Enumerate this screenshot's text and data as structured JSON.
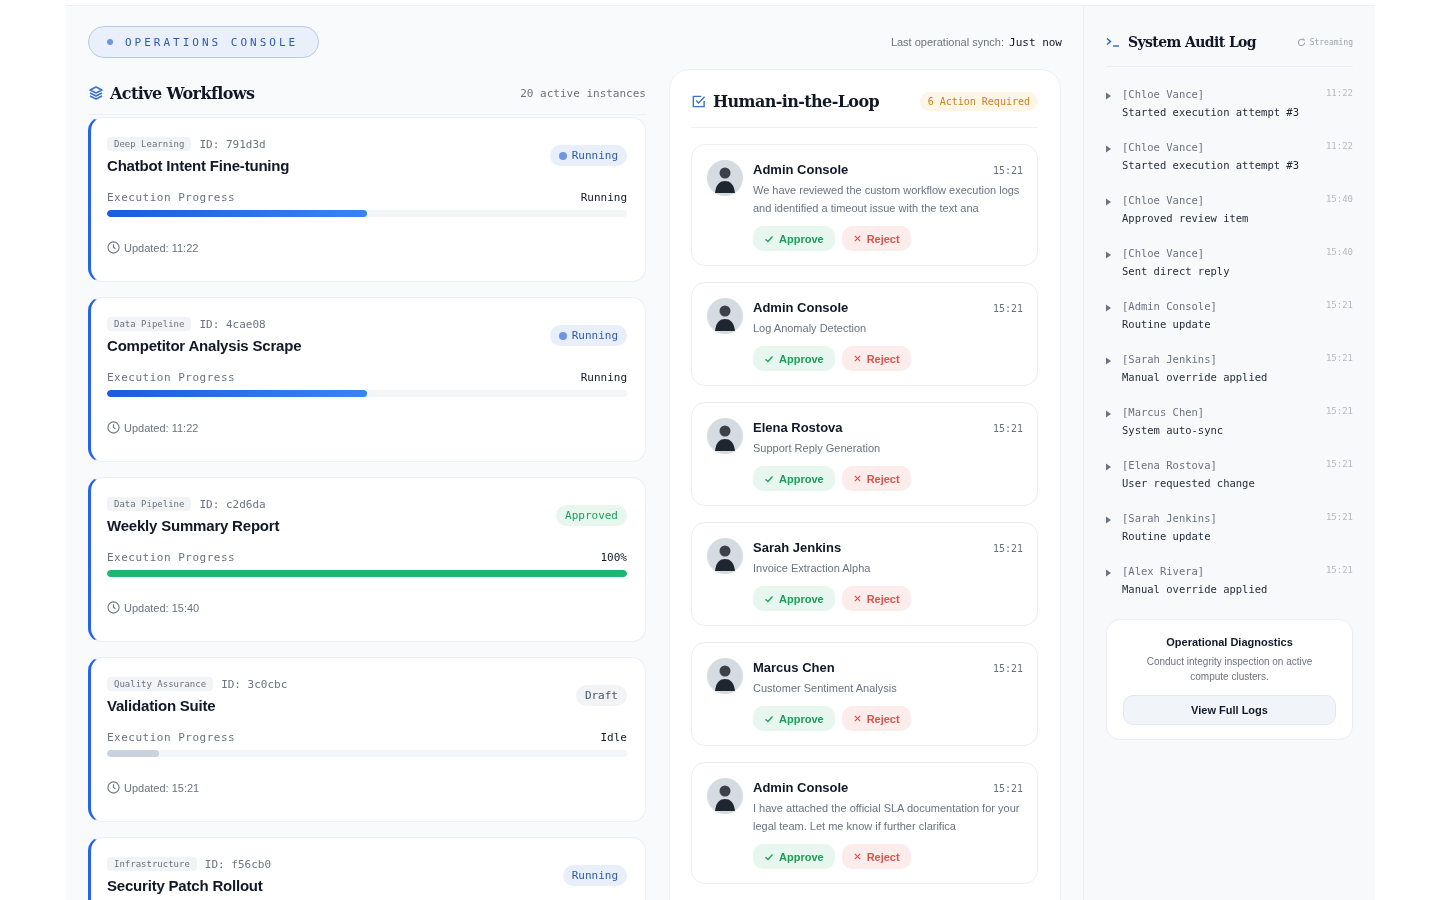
{
  "header": {
    "badge": "OPERATIONS CONSOLE",
    "sync_label": "Last operational synch:",
    "sync_value": "Just now"
  },
  "workflows": {
    "title": "Active Workflows",
    "count": "20 active instances",
    "items": [
      {
        "tag": "Deep Learning",
        "id": "ID: 791d3d",
        "title": "Chatbot Intent Fine-tuning",
        "status": {
          "kind": "running",
          "label": "Running",
          "dot": true
        },
        "progress_label": "Execution Progress",
        "progress_value": "Running",
        "level": 0.5,
        "updated": "Updated: 11:22"
      },
      {
        "tag": "Data Pipeline",
        "id": "ID: 4cae08",
        "title": "Competitor Analysis Scrape",
        "status": {
          "kind": "running",
          "label": "Running",
          "dot": true
        },
        "progress_label": "Execution Progress",
        "progress_value": "Running",
        "level": 0.5,
        "updated": "Updated: 11:22"
      },
      {
        "tag": "Data Pipeline",
        "id": "ID: c2d6da",
        "title": "Weekly Summary Report",
        "status": {
          "kind": "approved",
          "label": "Approved",
          "dot": false
        },
        "progress_label": "Execution Progress",
        "progress_value": "100%",
        "level": 1,
        "updated": "Updated: 15:40"
      },
      {
        "tag": "Quality Assurance",
        "id": "ID: 3c0cbc",
        "title": "Validation Suite",
        "status": {
          "kind": "draft",
          "label": "Draft",
          "dot": false
        },
        "progress_label": "Execution Progress",
        "progress_value": "Idle",
        "level": 0.1,
        "updated": "Updated: 15:21"
      },
      {
        "tag": "Infrastructure",
        "id": "ID: f56cb0",
        "title": "Security Patch Rollout",
        "status": {
          "kind": "running",
          "label": "Running",
          "dot": false
        }
      }
    ]
  },
  "review": {
    "title": "Human-in-the-Loop",
    "badge": "6 Action Required",
    "items": [
      {
        "name": "Admin Console",
        "time": "15:21",
        "text": "We have reviewed the custom workflow execution logs and identified a timeout issue with the text ana",
        "approve": "Approve",
        "reject": "Reject"
      },
      {
        "name": "Admin Console",
        "time": "15:21",
        "text": "Log Anomaly Detection",
        "approve": "Approve",
        "reject": "Reject"
      },
      {
        "name": "Elena Rostova",
        "time": "15:21",
        "text": "Support Reply Generation",
        "approve": "Approve",
        "reject": "Reject"
      },
      {
        "name": "Sarah Jenkins",
        "time": "15:21",
        "text": "Invoice Extraction Alpha",
        "approve": "Approve",
        "reject": "Reject"
      },
      {
        "name": "Marcus Chen",
        "time": "15:21",
        "text": "Customer Sentiment Analysis",
        "approve": "Approve",
        "reject": "Reject"
      },
      {
        "name": "Admin Console",
        "time": "15:21",
        "text": "I have attached the official SLA documentation for your legal team. Let me know if further clarifica",
        "approve": "Approve",
        "reject": "Reject"
      }
    ]
  },
  "audit": {
    "title": "System Audit Log",
    "status": "Streaming",
    "entries": [
      {
        "actor": "[Chloe Vance]",
        "time": "11:22",
        "message": "Started execution attempt #3"
      },
      {
        "actor": "[Chloe Vance]",
        "time": "11:22",
        "message": "Started execution attempt #3"
      },
      {
        "actor": "[Chloe Vance]",
        "time": "15:40",
        "message": "Approved review item"
      },
      {
        "actor": "[Chloe Vance]",
        "time": "15:40",
        "message": "Sent direct reply"
      },
      {
        "actor": "[Admin Console]",
        "time": "15:21",
        "message": "Routine update"
      },
      {
        "actor": "[Sarah Jenkins]",
        "time": "15:21",
        "message": "Manual override applied"
      },
      {
        "actor": "[Marcus Chen]",
        "time": "15:21",
        "message": "System auto-sync"
      },
      {
        "actor": "[Elena Rostova]",
        "time": "15:21",
        "message": "User requested change"
      },
      {
        "actor": "[Sarah Jenkins]",
        "time": "15:21",
        "message": "Routine update"
      },
      {
        "actor": "[Alex Rivera]",
        "time": "15:21",
        "message": "Manual override applied"
      }
    ]
  },
  "diagnostics": {
    "title": "Operational Diagnostics",
    "text": "Conduct integrity inspection on active compute clusters.",
    "button": "View Full Logs"
  }
}
